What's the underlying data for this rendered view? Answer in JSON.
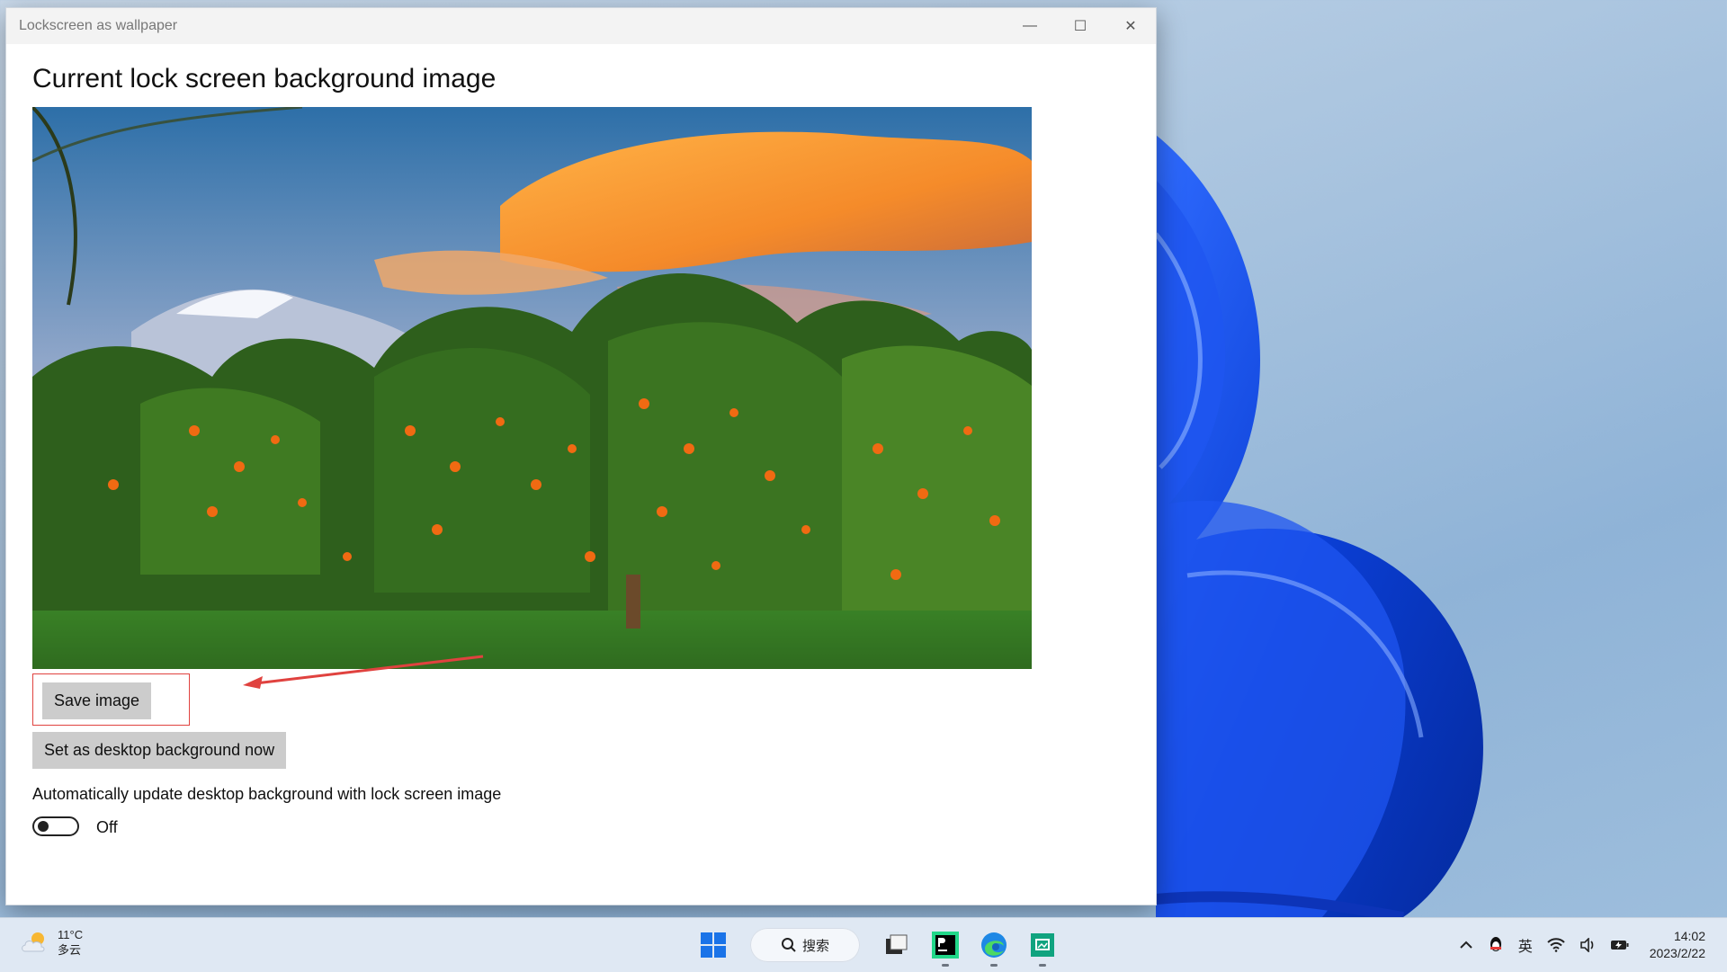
{
  "window": {
    "title": "Lockscreen as wallpaper",
    "minimize_label": "—",
    "maximize_label": "☐",
    "close_label": "✕"
  },
  "main": {
    "heading": "Current lock screen background image",
    "save_button": "Save image",
    "set_bg_button": "Set as desktop background now",
    "auto_update_label": "Automatically update desktop background with lock screen image",
    "toggle_state": "Off"
  },
  "taskbar": {
    "weather_temp": "11°C",
    "weather_desc": "多云",
    "search_label": "搜索",
    "ime_label": "英",
    "time": "14:02",
    "date": "2023/2/22"
  },
  "colors": {
    "annotation_red": "#e0423f",
    "button_gray": "#cccccc"
  }
}
